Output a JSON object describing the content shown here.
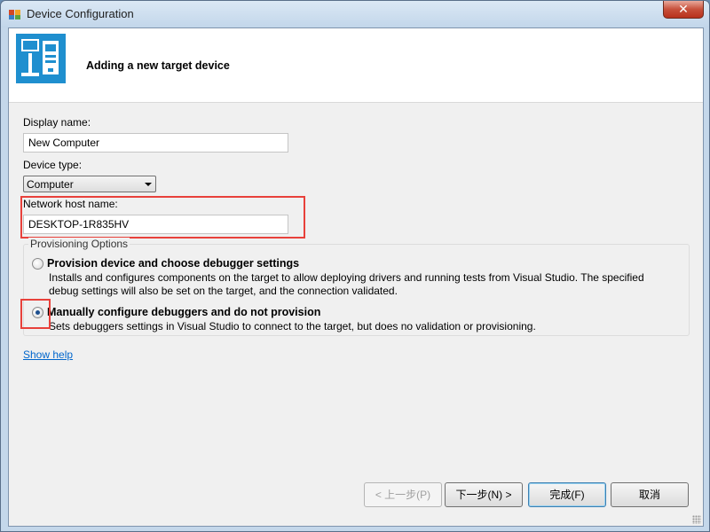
{
  "window": {
    "title": "Device Configuration",
    "close_label": "✕"
  },
  "header": {
    "title": "Adding a new target device",
    "icon": "device-config-icon"
  },
  "form": {
    "display_name_label": "Display name:",
    "display_name_value": "New Computer",
    "device_type_label": "Device type:",
    "device_type_value": "Computer",
    "host_label": "Network host name:",
    "host_value": "DESKTOP-1R835HV"
  },
  "provisioning": {
    "legend": "Provisioning Options",
    "options": [
      {
        "title": "Provision device and choose debugger settings",
        "desc": "Installs and configures components on the target to allow deploying drivers and running tests from Visual Studio. The specified debug settings will also be set on the target, and the connection validated.",
        "selected": false
      },
      {
        "title": "Manually configure debuggers and do not provision",
        "desc": "Sets debuggers settings in Visual Studio to connect to the target, but does no validation or provisioning.",
        "selected": true
      }
    ]
  },
  "show_help": "Show help",
  "buttons": {
    "back": "< 上一步(P)",
    "next": "下一步(N) >",
    "finish": "完成(F)",
    "cancel": "取消"
  },
  "colors": {
    "highlight": "#e8413b",
    "accent": "#1f8fcf",
    "link": "#0066cc"
  }
}
